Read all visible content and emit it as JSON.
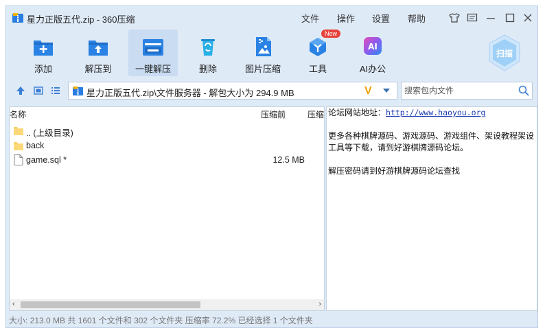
{
  "window": {
    "title": "星力正版五代.zip - 360压缩"
  },
  "menu": [
    "文件",
    "操作",
    "设置",
    "帮助"
  ],
  "toolbar": {
    "items": [
      {
        "label": "添加",
        "icon": "add-icon"
      },
      {
        "label": "解压到",
        "icon": "extract-to-icon"
      },
      {
        "label": "一键解压",
        "icon": "one-click-extract-icon"
      },
      {
        "label": "删除",
        "icon": "delete-icon"
      },
      {
        "label": "图片压缩",
        "icon": "image-compress-icon"
      },
      {
        "label": "工具",
        "icon": "tools-icon",
        "badge": "New"
      },
      {
        "label": "AI办公",
        "icon": "ai-office-icon",
        "icon_text": "AI"
      }
    ],
    "scan_label": "扫描"
  },
  "address": {
    "path": "星力正版五代.zip\\文件服务器 - 解包大小为 294.9 MB"
  },
  "search": {
    "placeholder": "搜索包内文件"
  },
  "columns": {
    "name": "名称",
    "size": "压缩前",
    "packed": "压缩"
  },
  "files": [
    {
      "name": ".. (上级目录)",
      "size": "",
      "type": "folder"
    },
    {
      "name": "back",
      "size": "",
      "type": "folder"
    },
    {
      "name": "game.sql *",
      "size": "12.5 MB",
      "type": "file"
    }
  ],
  "comment": {
    "line1_prefix": "论坛网站地址：",
    "line1_link": "http://www.haoyou.org",
    "para2": "更多各种棋牌源码、游戏源码、游戏组件、架设教程架设工具等下载，请到好游棋牌源码论坛。",
    "para3": "解压密码请到好游棋牌源码论坛查找"
  },
  "status": {
    "text": "大小: 213.0 MB 共 1601 个文件和 302 个文件夹 压缩率 72.2% 已经选择 1 个文件夹"
  },
  "colors": {
    "window_bg": "#dfeaf7",
    "accent_blue": "#2a82e4",
    "badge_red": "#e8423b"
  }
}
